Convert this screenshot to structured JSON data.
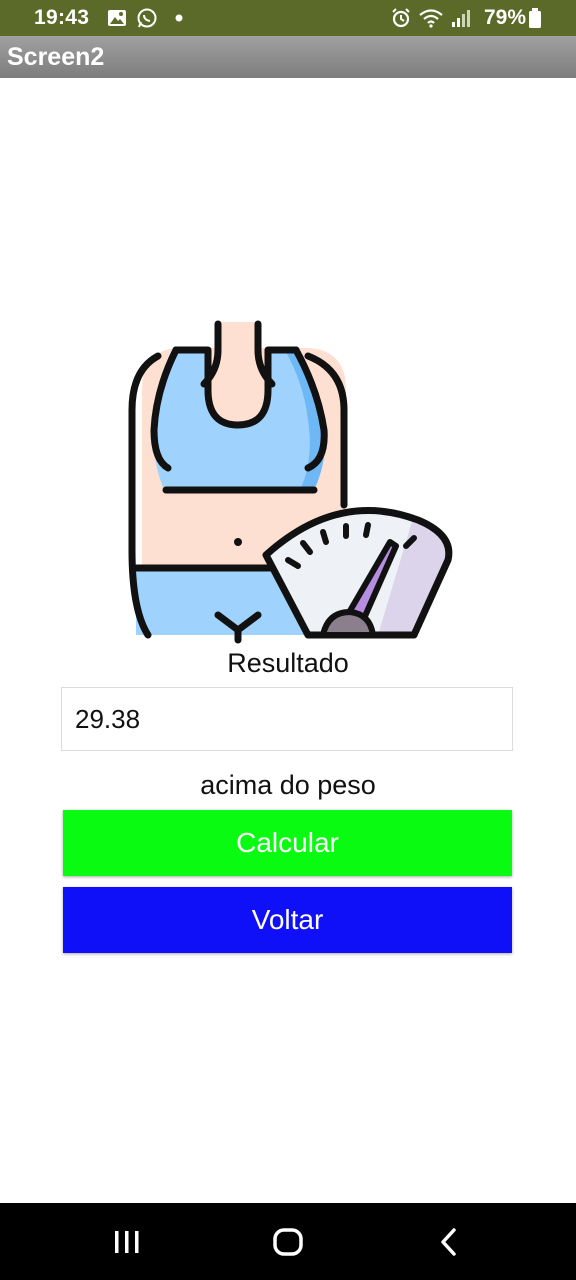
{
  "status_bar": {
    "time": "19:43",
    "battery": "79%",
    "icons": [
      "image-icon",
      "whatsapp-icon",
      "dot-icon",
      "alarm-icon",
      "wifi-icon",
      "signal-icon",
      "battery-icon"
    ]
  },
  "title_bar": {
    "title": "Screen2"
  },
  "main": {
    "illustration": "body-weight-scale-illustration",
    "result_label": "Resultado",
    "result_value": "29.38",
    "status_text": "acima do peso",
    "calc_label": "Calcular",
    "back_label": "Voltar"
  },
  "nav_bar": {
    "icons": [
      "recent-apps-icon",
      "home-icon",
      "back-icon"
    ]
  },
  "colors": {
    "status_bar": "#5b6a28",
    "calc_button": "#0afb12",
    "back_button": "#1010f8"
  }
}
